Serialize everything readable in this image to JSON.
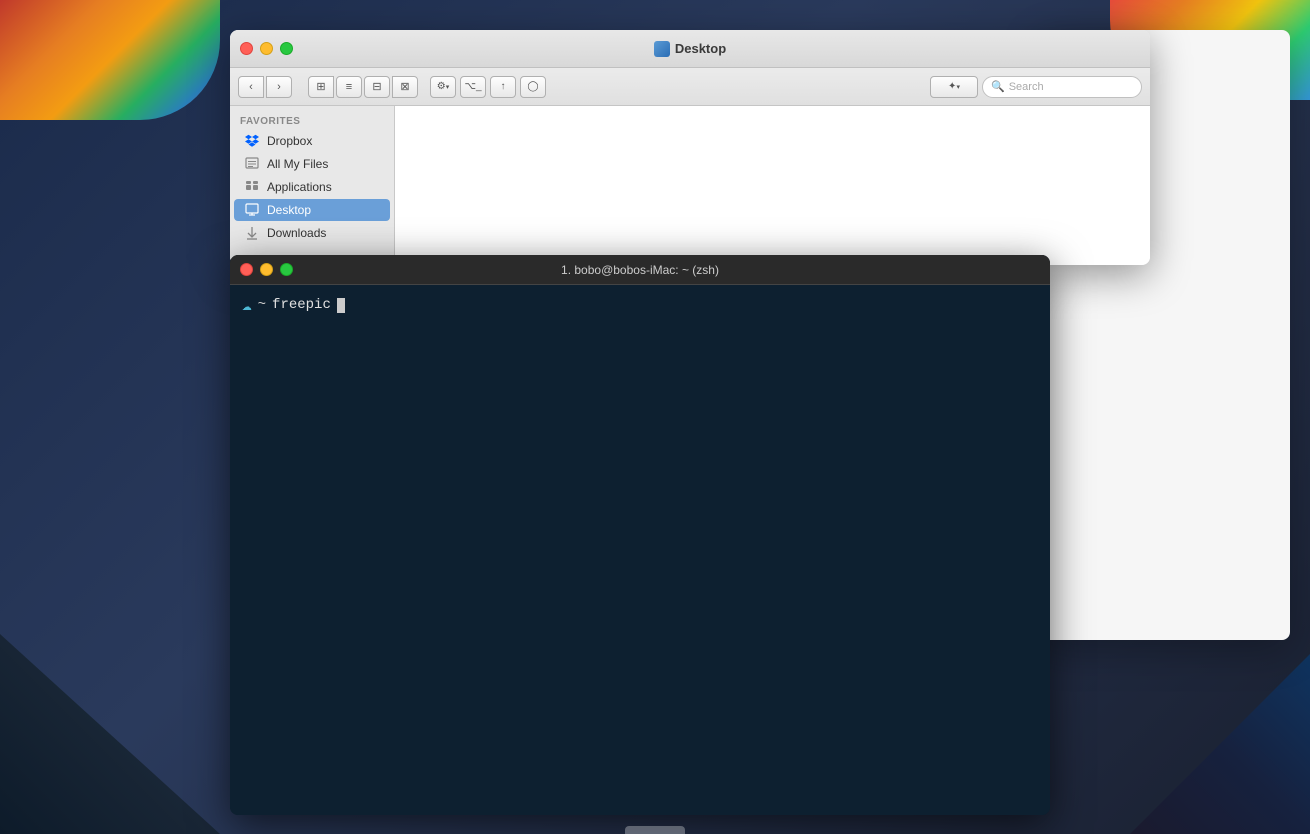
{
  "desktop": {
    "bg_desc": "macOS desktop background"
  },
  "finder": {
    "title": "Desktop",
    "title_icon": "folder-icon",
    "traffic_lights": {
      "close_label": "close",
      "minimize_label": "minimize",
      "maximize_label": "maximize"
    },
    "toolbar": {
      "back_label": "‹",
      "forward_label": "›",
      "view_icon_label": "⊞",
      "view_list_label": "≡",
      "view_column_label": "⊟",
      "view_cover_label": "⊠",
      "action_label": "⚙",
      "share_label": "↑",
      "tag_label": "◯",
      "path_label": "⌥_",
      "dropbox_label": "✦",
      "search_placeholder": "Search"
    },
    "sidebar": {
      "favorites_label": "Favorites",
      "items": [
        {
          "id": "dropbox",
          "label": "Dropbox",
          "icon": "dropbox"
        },
        {
          "id": "all-my-files",
          "label": "All My Files",
          "icon": "files"
        },
        {
          "id": "applications",
          "label": "Applications",
          "icon": "apps"
        },
        {
          "id": "desktop",
          "label": "Desktop",
          "icon": "desktop",
          "active": true
        },
        {
          "id": "downloads",
          "label": "Downloads",
          "icon": "downloads"
        }
      ]
    }
  },
  "terminal": {
    "title": "1. bobo@bobos-iMac: ~ (zsh)",
    "traffic_lights": {
      "close_label": "close",
      "minimize_label": "minimize",
      "maximize_label": "maximize"
    },
    "prompt": {
      "cloud": "☁",
      "tilde": "~",
      "command": "freepic",
      "cursor": ""
    }
  },
  "dock_hint": ""
}
